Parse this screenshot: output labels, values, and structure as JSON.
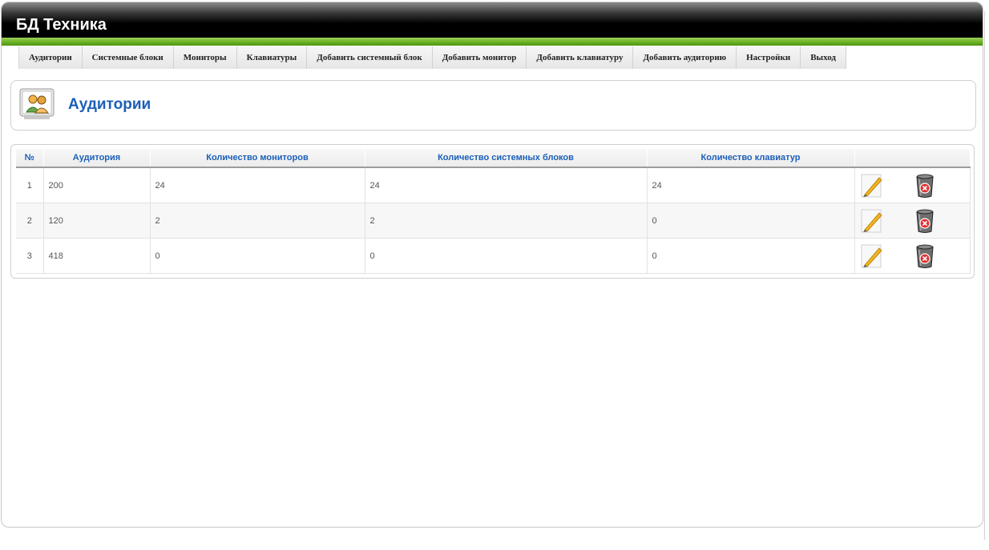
{
  "header": {
    "title": "БД Техника"
  },
  "nav": [
    "Аудитории",
    "Системные блоки",
    "Мониторы",
    "Клавиатуры",
    "Добавить системный блок",
    "Добавить монитор",
    "Добавить клавиатуру",
    "Добавить аудиторию",
    "Настройки",
    "Выход"
  ],
  "page": {
    "title": "Аудитории",
    "icon": "users-icon"
  },
  "table": {
    "headers": [
      "№",
      "Аудитория",
      "Количество мониторов",
      "Количество системных блоков",
      "Количество клавиатур",
      ""
    ],
    "rows": [
      [
        "1",
        "200",
        "24",
        "24",
        "24"
      ],
      [
        "2",
        "120",
        "2",
        "2",
        "0"
      ],
      [
        "3",
        "418",
        "0",
        "0",
        "0"
      ]
    ],
    "row_actions": [
      "edit-icon",
      "delete-icon"
    ]
  },
  "colors": {
    "accent_blue": "#1b5fb8",
    "header_black": "#000000",
    "green_bar": "#6bb324"
  }
}
